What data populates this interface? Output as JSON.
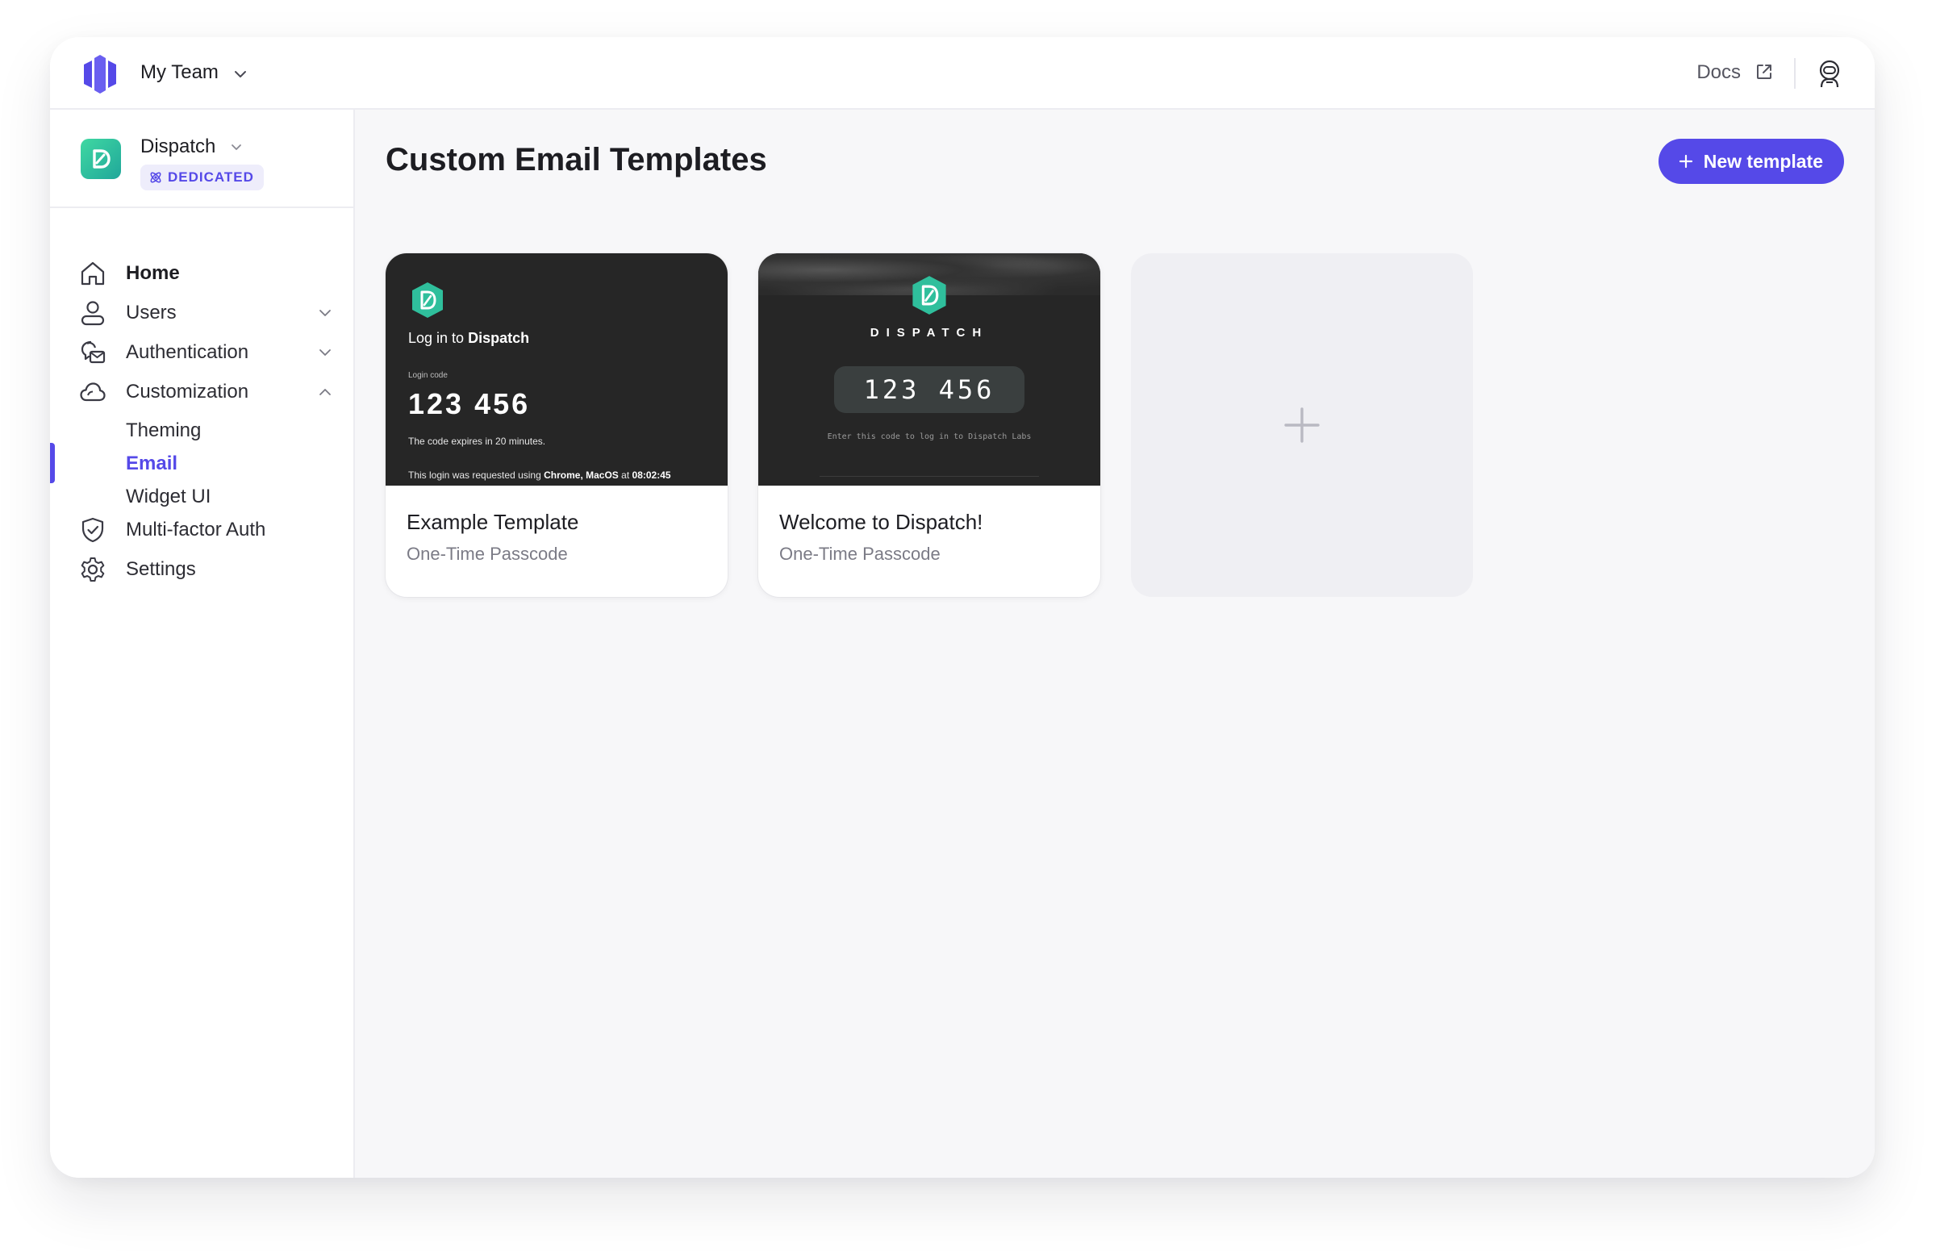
{
  "topbar": {
    "team_name": "My Team",
    "docs_label": "Docs",
    "icons": [
      "stytch-logo-icon",
      "chevron-down-icon",
      "external-link-icon",
      "user-avatar-icon"
    ]
  },
  "project": {
    "name": "Dispatch",
    "badge": "DEDICATED"
  },
  "sidebar": {
    "items": [
      {
        "label": "Home",
        "icon": "home-icon"
      },
      {
        "label": "Users",
        "icon": "user-icon"
      },
      {
        "label": "Authentication",
        "icon": "authentication-icon"
      },
      {
        "label": "Customization",
        "icon": "cloud-icon"
      },
      {
        "label": "Multi-factor Auth",
        "icon": "shield-check-icon"
      },
      {
        "label": "Settings",
        "icon": "gear-icon"
      }
    ],
    "customization_sub": [
      {
        "label": "Theming"
      },
      {
        "label": "Email",
        "active": true
      },
      {
        "label": "Widget UI"
      }
    ]
  },
  "main": {
    "title": "Custom Email Templates",
    "new_button": "New template"
  },
  "templates": [
    {
      "name": "Example Template",
      "type": "One-Time Passcode",
      "preview": {
        "heading_prefix": "Log in to",
        "heading_brand": "Dispatch",
        "code_label": "Login code",
        "code": "123 456",
        "expires": "The code expires in 20 minutes.",
        "footer_prefix": "This login was requested using",
        "footer_device": "Chrome, MacOS",
        "footer_at": "at",
        "footer_time": "08:02:45"
      }
    },
    {
      "name": "Welcome to Dispatch!",
      "type": "One-Time Passcode",
      "preview": {
        "wordmark": "DISPATCH",
        "code": "123 456",
        "hint": "Enter this code to log in to Dispatch Labs"
      }
    }
  ],
  "colors": {
    "accent": "#5549e8",
    "brand_green": "#2fbf9c",
    "preview_dark": "#262626"
  }
}
